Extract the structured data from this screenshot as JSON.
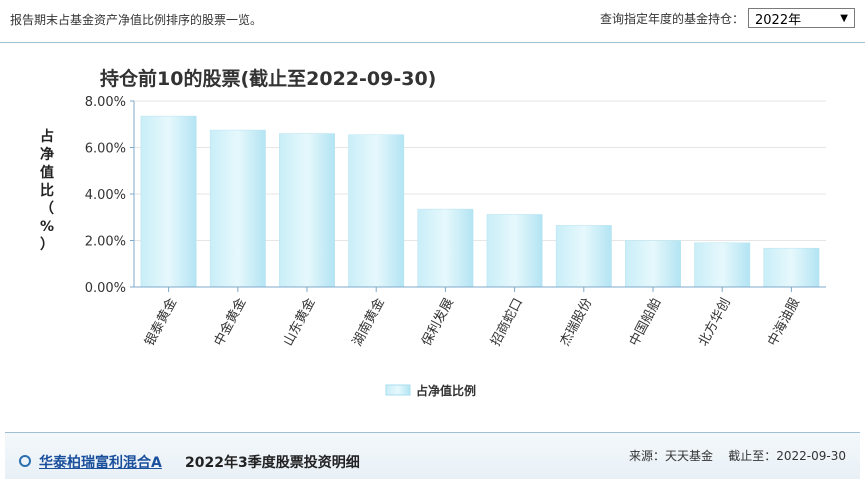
{
  "header": {
    "description": "报告期末占基金资产净值比例排序的股票一览。",
    "year_label": "查询指定年度的基金持仓：",
    "year_value": "2022年",
    "chevron_icon": "chevron-down-icon"
  },
  "footer": {
    "fund_name": "华泰柏瑞富利混合A",
    "period_title": "2022年3季度股票投资明细",
    "source_label": "来源：天天基金",
    "cutoff_label": "截止至：2022-09-30"
  },
  "chart_data": {
    "type": "bar",
    "title": "持仓前10的股票(截止至2022-09-30)",
    "ylabel": "占净值比（%）",
    "xlabel": "",
    "ylim": [
      0,
      8
    ],
    "y_ticks": [
      "0.00%",
      "2.00%",
      "4.00%",
      "6.00%",
      "8.00%"
    ],
    "categories": [
      "银泰黄金",
      "中金黄金",
      "山东黄金",
      "湖南黄金",
      "保利发展",
      "招商蛇口",
      "杰瑞股份",
      "中国船舶",
      "北方华创",
      "中海油服"
    ],
    "series": [
      {
        "name": "占净值比例",
        "values": [
          7.35,
          6.75,
          6.6,
          6.55,
          3.35,
          3.12,
          2.65,
          2.0,
          1.9,
          1.67
        ]
      }
    ],
    "grid": true,
    "legend_position": "bottom",
    "colors": {
      "bar_top": "#e2f6fb",
      "bar_bottom": "#a8def0",
      "grid": "#e6e6e6",
      "axis": "#7fa9c9",
      "title": "#333333"
    }
  }
}
